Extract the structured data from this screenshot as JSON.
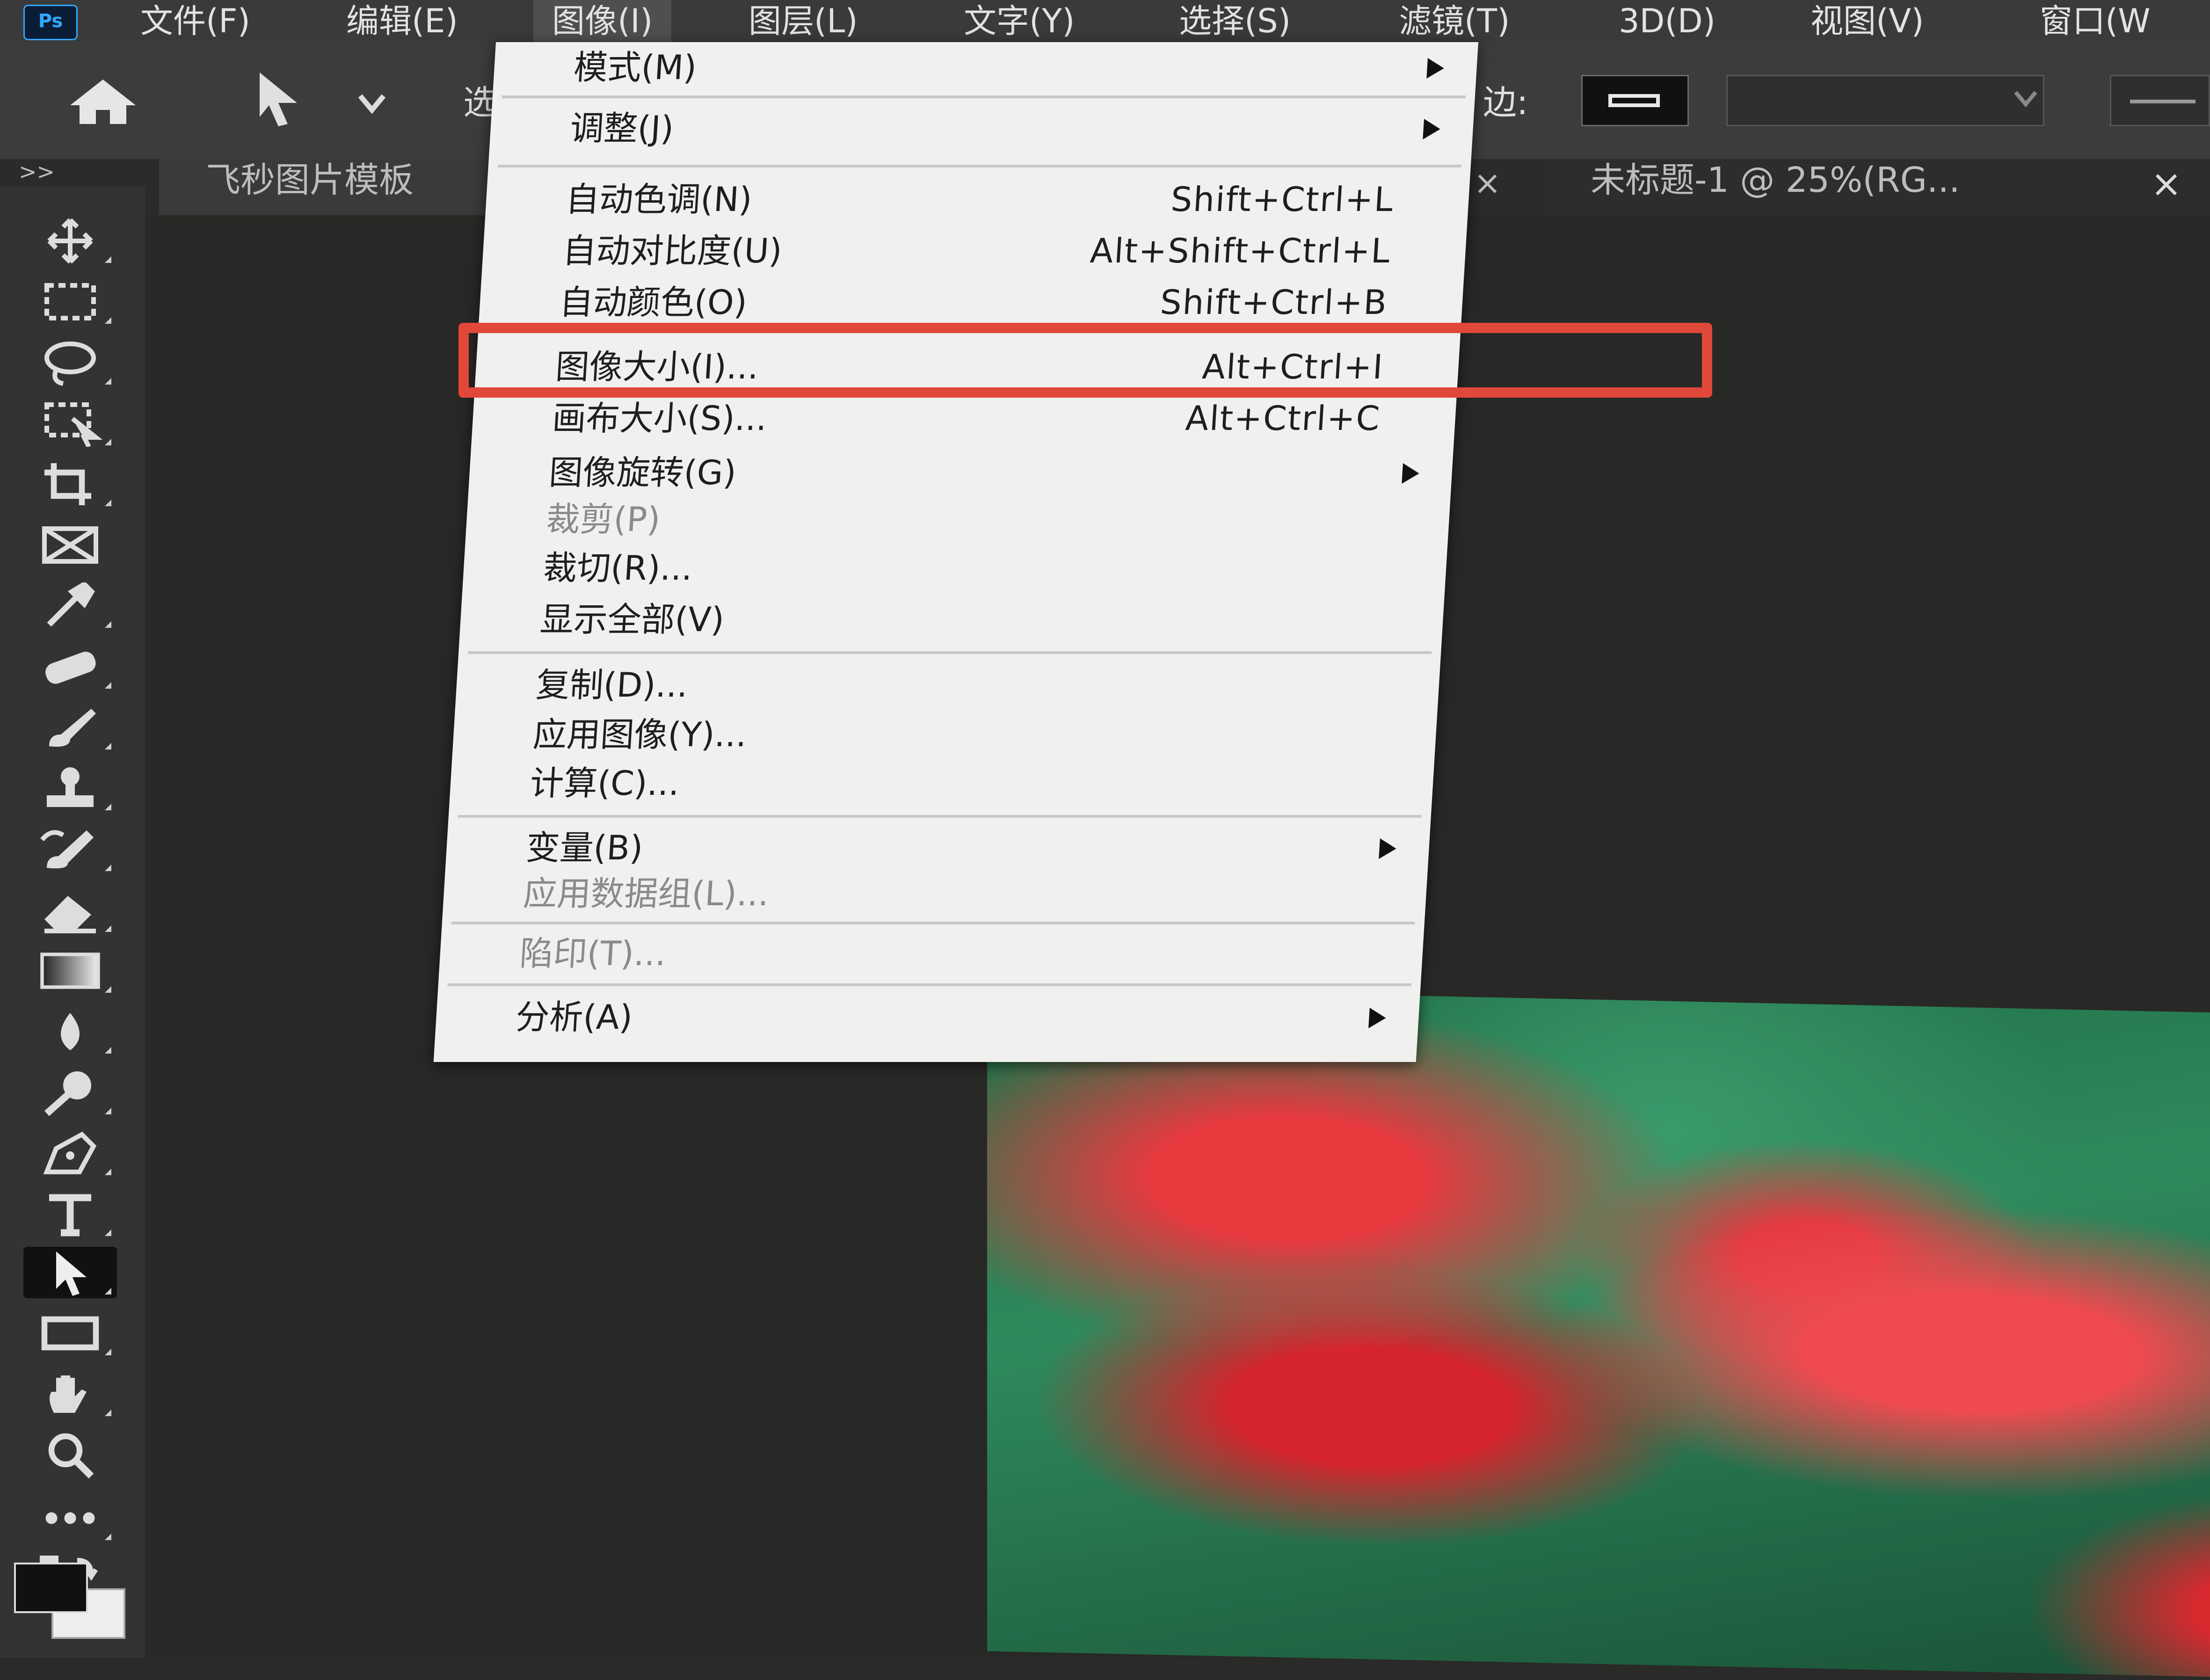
{
  "app": {
    "logo": "Ps"
  },
  "menubar": {
    "items": [
      {
        "label": "文件(F)"
      },
      {
        "label": "编辑(E)"
      },
      {
        "label": "图像(I)"
      },
      {
        "label": "图层(L)"
      },
      {
        "label": "文字(Y)"
      },
      {
        "label": "选择(S)"
      },
      {
        "label": "滤镜(T)"
      },
      {
        "label": "3D(D)"
      },
      {
        "label": "视图(V)"
      },
      {
        "label": "窗口(W"
      }
    ],
    "active_menu": "图像(I)"
  },
  "options_bar": {
    "home_icon": "home-icon",
    "tool_icon": "path-selection-arrow-icon",
    "select_label": "选",
    "edge_label": "边:"
  },
  "tabs": {
    "collapse_label": ">>",
    "tab1_label": "飞秒图片模板",
    "tab1_close": "×",
    "tab2_label": "未标题-1 @ 25%(RG...",
    "tab2_close": "×"
  },
  "image_menu": {
    "items": [
      {
        "label": "模式(M)",
        "shortcut": "",
        "submenu": true,
        "disabled": false
      },
      {
        "label": "调整(J)",
        "shortcut": "",
        "submenu": true,
        "disabled": false
      },
      {
        "label": "自动色调(N)",
        "shortcut": "Shift+Ctrl+L",
        "submenu": false,
        "disabled": false
      },
      {
        "label": "自动对比度(U)",
        "shortcut": "Alt+Shift+Ctrl+L",
        "submenu": false,
        "disabled": false
      },
      {
        "label": "自动颜色(O)",
        "shortcut": "Shift+Ctrl+B",
        "submenu": false,
        "disabled": false
      },
      {
        "label": "图像大小(I)...",
        "shortcut": "Alt+Ctrl+I",
        "submenu": false,
        "disabled": false,
        "highlighted": true
      },
      {
        "label": "画布大小(S)...",
        "shortcut": "Alt+Ctrl+C",
        "submenu": false,
        "disabled": false
      },
      {
        "label": "图像旋转(G)",
        "shortcut": "",
        "submenu": true,
        "disabled": false
      },
      {
        "label": "裁剪(P)",
        "shortcut": "",
        "submenu": false,
        "disabled": true
      },
      {
        "label": "裁切(R)...",
        "shortcut": "",
        "submenu": false,
        "disabled": false
      },
      {
        "label": "显示全部(V)",
        "shortcut": "",
        "submenu": false,
        "disabled": false
      },
      {
        "label": "复制(D)...",
        "shortcut": "",
        "submenu": false,
        "disabled": false
      },
      {
        "label": "应用图像(Y)...",
        "shortcut": "",
        "submenu": false,
        "disabled": false
      },
      {
        "label": "计算(C)...",
        "shortcut": "",
        "submenu": false,
        "disabled": false
      },
      {
        "label": "变量(B)",
        "shortcut": "",
        "submenu": true,
        "disabled": false
      },
      {
        "label": "应用数据组(L)...",
        "shortcut": "",
        "submenu": false,
        "disabled": true
      },
      {
        "label": "陷印(T)...",
        "shortcut": "",
        "submenu": false,
        "disabled": true
      },
      {
        "label": "分析(A)",
        "shortcut": "",
        "submenu": true,
        "disabled": false
      }
    ],
    "highlight_color": "#e0483a"
  },
  "toolbar": {
    "tools": [
      "move-icon",
      "marquee-icon",
      "lasso-icon",
      "object-select-icon",
      "crop-icon",
      "frame-icon",
      "eyedropper-icon",
      "healing-brush-icon",
      "brush-icon",
      "stamp-icon",
      "history-brush-icon",
      "eraser-icon",
      "gradient-icon",
      "blur-icon",
      "dodge-icon",
      "pen-icon",
      "type-icon",
      "path-select-icon",
      "rectangle-icon",
      "hand-icon",
      "zoom-icon",
      "more-tools-icon"
    ],
    "selected_tool": "path-select-icon"
  },
  "canvas": {
    "image_subject": "red-roses-photo"
  }
}
